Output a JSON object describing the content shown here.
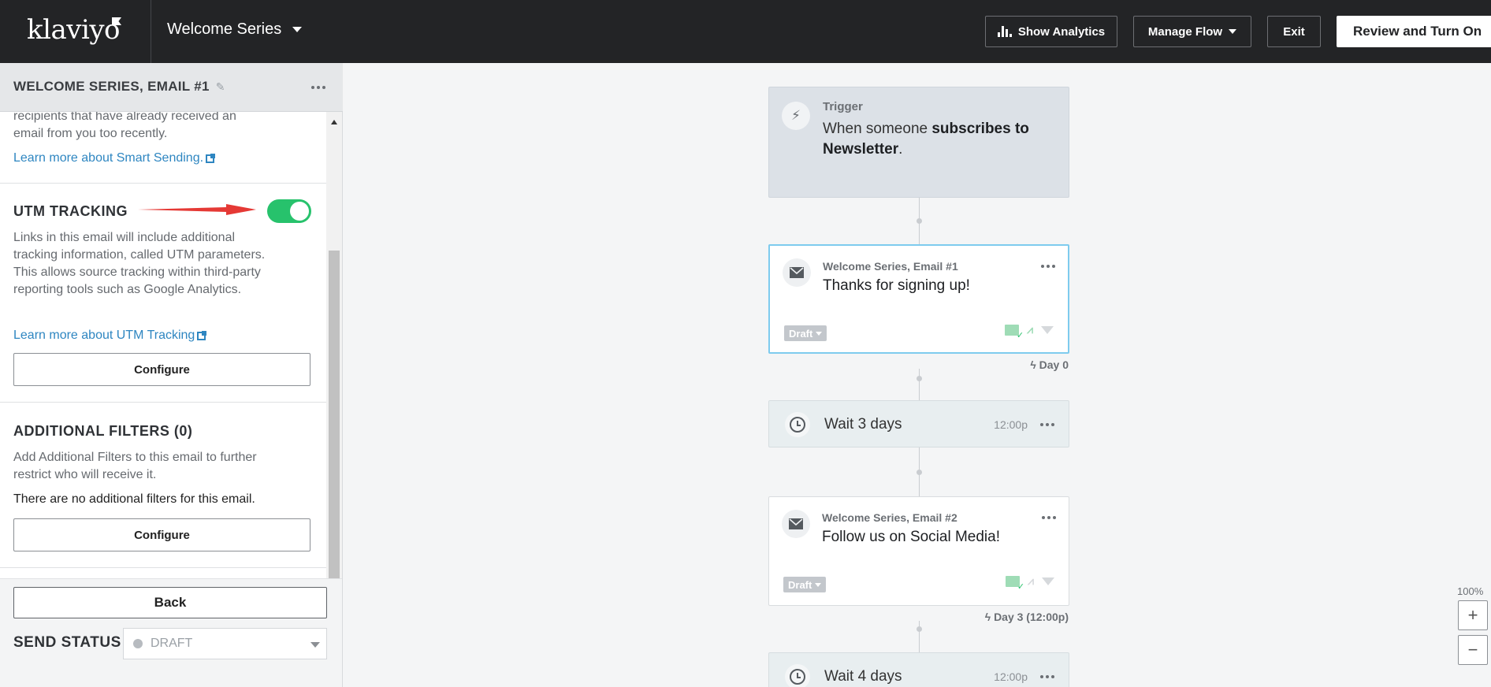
{
  "topbar": {
    "logo": "klaviyo",
    "flow_name": "Welcome Series",
    "show_analytics": "Show Analytics",
    "manage_flow": "Manage Flow",
    "exit": "Exit",
    "review": "Review and Turn On"
  },
  "panel": {
    "header_title": "WELCOME SERIES, EMAIL #1",
    "smart_sending_partial_1": "recipients that have already received an",
    "smart_sending_partial_2": "email from you too recently.",
    "smart_sending_link": "Learn more about Smart Sending.",
    "utm_title": "UTM TRACKING",
    "utm_enabled": true,
    "utm_desc": "Links in this email will include additional tracking information, called UTM parameters. This allows source tracking within third-party reporting tools such as Google Analytics.",
    "utm_link": "Learn more about UTM Tracking",
    "configure": "Configure",
    "filters_title": "ADDITIONAL FILTERS (0)",
    "filters_desc": "Add Additional Filters to this email to further restrict who will receive it.",
    "filters_none": "There are no additional filters for this email.",
    "back": "Back",
    "send_status_label": "SEND STATUS",
    "send_status_value": "DRAFT"
  },
  "canvas": {
    "trigger": {
      "label": "Trigger",
      "text_prefix": "When someone ",
      "text_bold": "subscribes to Newsletter",
      "text_suffix": "."
    },
    "email1": {
      "name": "Welcome Series, Email #1",
      "subject": "Thanks for signing up!",
      "status": "Draft"
    },
    "day0": "Day 0",
    "wait1": {
      "text": "Wait 3 days",
      "time": "12:00p"
    },
    "email2": {
      "name": "Welcome Series, Email #2",
      "subject": "Follow us on Social Media!",
      "status": "Draft"
    },
    "day3": "Day 3 (12:00p)",
    "wait2": {
      "text": "Wait 4 days",
      "time": "12:00p"
    },
    "zoom": "100%",
    "zoom_in": "+",
    "zoom_out": "−"
  },
  "colors": {
    "topbar": "#232426",
    "toggle_on": "#27c26c",
    "link": "#2e86c1",
    "annotation_arrow": "#e53935",
    "selected_border": "#7ecbee"
  }
}
